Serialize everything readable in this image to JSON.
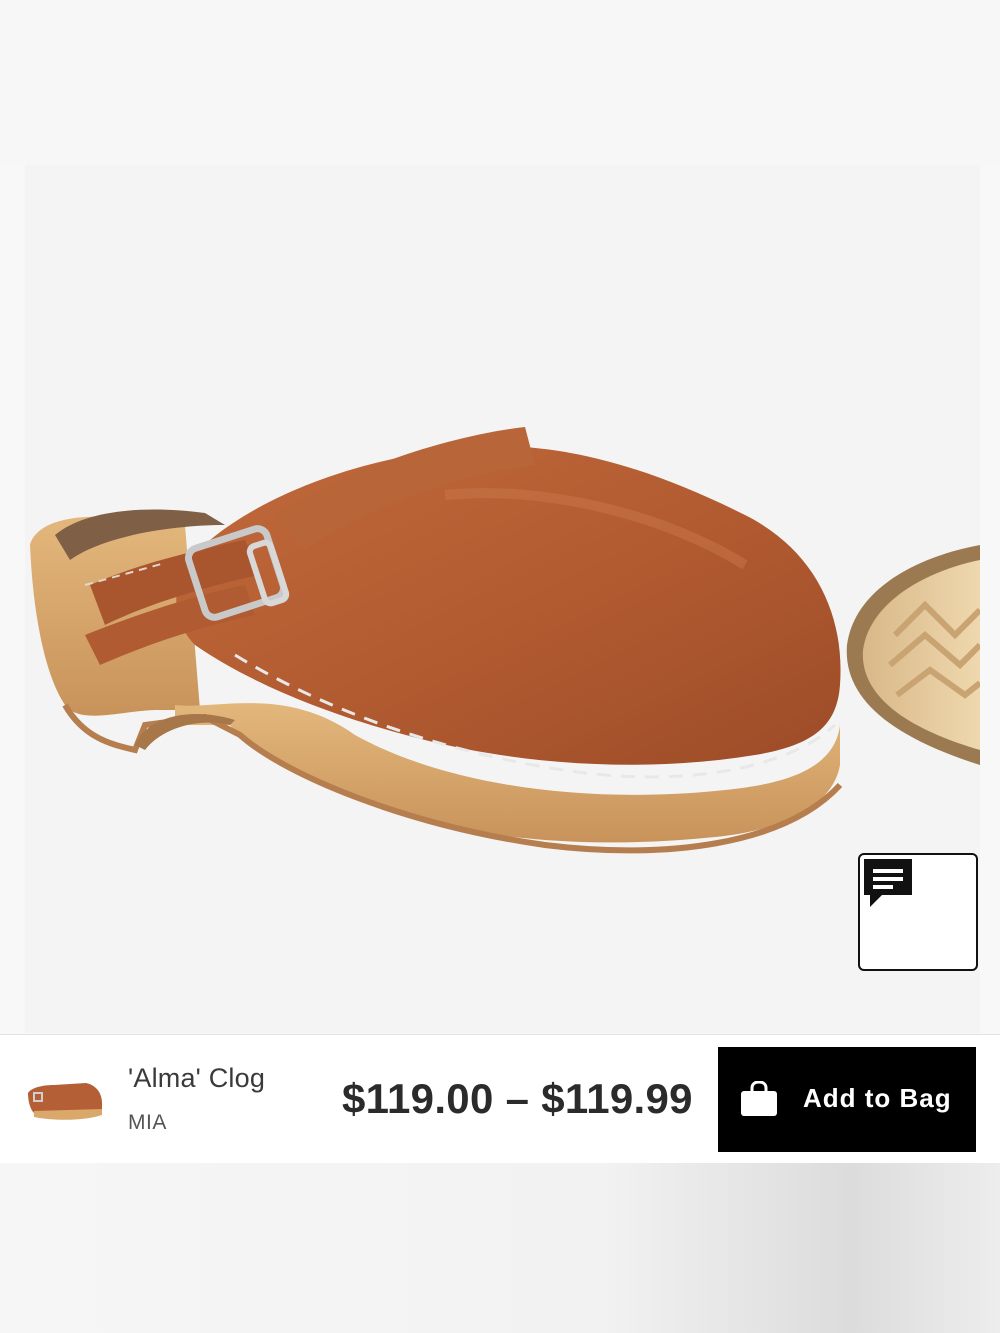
{
  "product": {
    "name": "'Alma' Clog",
    "brand": "MIA",
    "price": "$119.00 – $119.99",
    "image_alt": "Tan leather clog with wooden sole and buckle strap"
  },
  "actions": {
    "add_to_bag_label": "Add to Bag",
    "bag_icon": "shopping-bag-icon",
    "chat_icon": "chat-bubble-icon"
  },
  "colors": {
    "button_bg": "#000000",
    "button_text": "#ffffff",
    "leather": "#b45f35",
    "wood": "#d9a86a"
  }
}
